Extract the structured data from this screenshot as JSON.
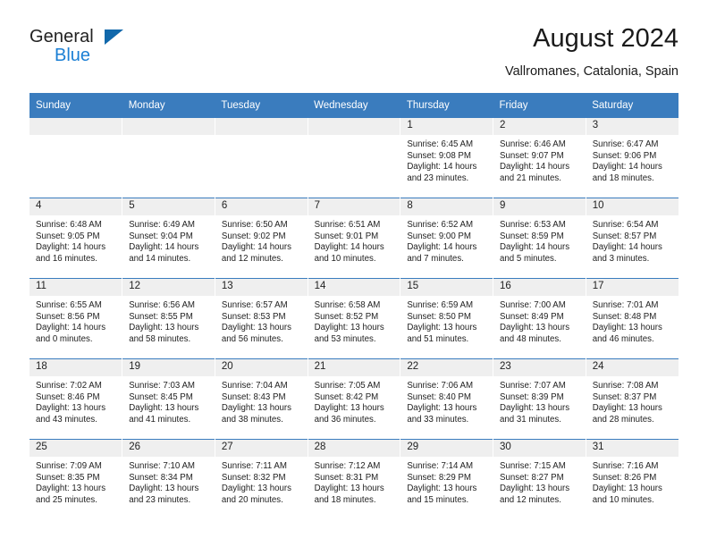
{
  "brand": {
    "name_top": "General",
    "name_bottom": "Blue",
    "triangle_color": "#1168ab",
    "blue_color": "#1b7fd4"
  },
  "header": {
    "title": "August 2024",
    "subtitle": "Vallromanes, Catalonia, Spain"
  },
  "theme": {
    "header_bg": "#3a7cbe",
    "header_text": "#ffffff",
    "daynum_bg": "#efefef",
    "cell_bg": "#ffffff",
    "text": "#222222"
  },
  "calendar": {
    "weekday_headers": [
      "Sunday",
      "Monday",
      "Tuesday",
      "Wednesday",
      "Thursday",
      "Friday",
      "Saturday"
    ],
    "weeks": [
      [
        {
          "day": "",
          "lines": []
        },
        {
          "day": "",
          "lines": []
        },
        {
          "day": "",
          "lines": []
        },
        {
          "day": "",
          "lines": []
        },
        {
          "day": "1",
          "lines": [
            "Sunrise: 6:45 AM",
            "Sunset: 9:08 PM",
            "Daylight: 14 hours",
            "and 23 minutes."
          ]
        },
        {
          "day": "2",
          "lines": [
            "Sunrise: 6:46 AM",
            "Sunset: 9:07 PM",
            "Daylight: 14 hours",
            "and 21 minutes."
          ]
        },
        {
          "day": "3",
          "lines": [
            "Sunrise: 6:47 AM",
            "Sunset: 9:06 PM",
            "Daylight: 14 hours",
            "and 18 minutes."
          ]
        }
      ],
      [
        {
          "day": "4",
          "lines": [
            "Sunrise: 6:48 AM",
            "Sunset: 9:05 PM",
            "Daylight: 14 hours",
            "and 16 minutes."
          ]
        },
        {
          "day": "5",
          "lines": [
            "Sunrise: 6:49 AM",
            "Sunset: 9:04 PM",
            "Daylight: 14 hours",
            "and 14 minutes."
          ]
        },
        {
          "day": "6",
          "lines": [
            "Sunrise: 6:50 AM",
            "Sunset: 9:02 PM",
            "Daylight: 14 hours",
            "and 12 minutes."
          ]
        },
        {
          "day": "7",
          "lines": [
            "Sunrise: 6:51 AM",
            "Sunset: 9:01 PM",
            "Daylight: 14 hours",
            "and 10 minutes."
          ]
        },
        {
          "day": "8",
          "lines": [
            "Sunrise: 6:52 AM",
            "Sunset: 9:00 PM",
            "Daylight: 14 hours",
            "and 7 minutes."
          ]
        },
        {
          "day": "9",
          "lines": [
            "Sunrise: 6:53 AM",
            "Sunset: 8:59 PM",
            "Daylight: 14 hours",
            "and 5 minutes."
          ]
        },
        {
          "day": "10",
          "lines": [
            "Sunrise: 6:54 AM",
            "Sunset: 8:57 PM",
            "Daylight: 14 hours",
            "and 3 minutes."
          ]
        }
      ],
      [
        {
          "day": "11",
          "lines": [
            "Sunrise: 6:55 AM",
            "Sunset: 8:56 PM",
            "Daylight: 14 hours",
            "and 0 minutes."
          ]
        },
        {
          "day": "12",
          "lines": [
            "Sunrise: 6:56 AM",
            "Sunset: 8:55 PM",
            "Daylight: 13 hours",
            "and 58 minutes."
          ]
        },
        {
          "day": "13",
          "lines": [
            "Sunrise: 6:57 AM",
            "Sunset: 8:53 PM",
            "Daylight: 13 hours",
            "and 56 minutes."
          ]
        },
        {
          "day": "14",
          "lines": [
            "Sunrise: 6:58 AM",
            "Sunset: 8:52 PM",
            "Daylight: 13 hours",
            "and 53 minutes."
          ]
        },
        {
          "day": "15",
          "lines": [
            "Sunrise: 6:59 AM",
            "Sunset: 8:50 PM",
            "Daylight: 13 hours",
            "and 51 minutes."
          ]
        },
        {
          "day": "16",
          "lines": [
            "Sunrise: 7:00 AM",
            "Sunset: 8:49 PM",
            "Daylight: 13 hours",
            "and 48 minutes."
          ]
        },
        {
          "day": "17",
          "lines": [
            "Sunrise: 7:01 AM",
            "Sunset: 8:48 PM",
            "Daylight: 13 hours",
            "and 46 minutes."
          ]
        }
      ],
      [
        {
          "day": "18",
          "lines": [
            "Sunrise: 7:02 AM",
            "Sunset: 8:46 PM",
            "Daylight: 13 hours",
            "and 43 minutes."
          ]
        },
        {
          "day": "19",
          "lines": [
            "Sunrise: 7:03 AM",
            "Sunset: 8:45 PM",
            "Daylight: 13 hours",
            "and 41 minutes."
          ]
        },
        {
          "day": "20",
          "lines": [
            "Sunrise: 7:04 AM",
            "Sunset: 8:43 PM",
            "Daylight: 13 hours",
            "and 38 minutes."
          ]
        },
        {
          "day": "21",
          "lines": [
            "Sunrise: 7:05 AM",
            "Sunset: 8:42 PM",
            "Daylight: 13 hours",
            "and 36 minutes."
          ]
        },
        {
          "day": "22",
          "lines": [
            "Sunrise: 7:06 AM",
            "Sunset: 8:40 PM",
            "Daylight: 13 hours",
            "and 33 minutes."
          ]
        },
        {
          "day": "23",
          "lines": [
            "Sunrise: 7:07 AM",
            "Sunset: 8:39 PM",
            "Daylight: 13 hours",
            "and 31 minutes."
          ]
        },
        {
          "day": "24",
          "lines": [
            "Sunrise: 7:08 AM",
            "Sunset: 8:37 PM",
            "Daylight: 13 hours",
            "and 28 minutes."
          ]
        }
      ],
      [
        {
          "day": "25",
          "lines": [
            "Sunrise: 7:09 AM",
            "Sunset: 8:35 PM",
            "Daylight: 13 hours",
            "and 25 minutes."
          ]
        },
        {
          "day": "26",
          "lines": [
            "Sunrise: 7:10 AM",
            "Sunset: 8:34 PM",
            "Daylight: 13 hours",
            "and 23 minutes."
          ]
        },
        {
          "day": "27",
          "lines": [
            "Sunrise: 7:11 AM",
            "Sunset: 8:32 PM",
            "Daylight: 13 hours",
            "and 20 minutes."
          ]
        },
        {
          "day": "28",
          "lines": [
            "Sunrise: 7:12 AM",
            "Sunset: 8:31 PM",
            "Daylight: 13 hours",
            "and 18 minutes."
          ]
        },
        {
          "day": "29",
          "lines": [
            "Sunrise: 7:14 AM",
            "Sunset: 8:29 PM",
            "Daylight: 13 hours",
            "and 15 minutes."
          ]
        },
        {
          "day": "30",
          "lines": [
            "Sunrise: 7:15 AM",
            "Sunset: 8:27 PM",
            "Daylight: 13 hours",
            "and 12 minutes."
          ]
        },
        {
          "day": "31",
          "lines": [
            "Sunrise: 7:16 AM",
            "Sunset: 8:26 PM",
            "Daylight: 13 hours",
            "and 10 minutes."
          ]
        }
      ]
    ]
  }
}
